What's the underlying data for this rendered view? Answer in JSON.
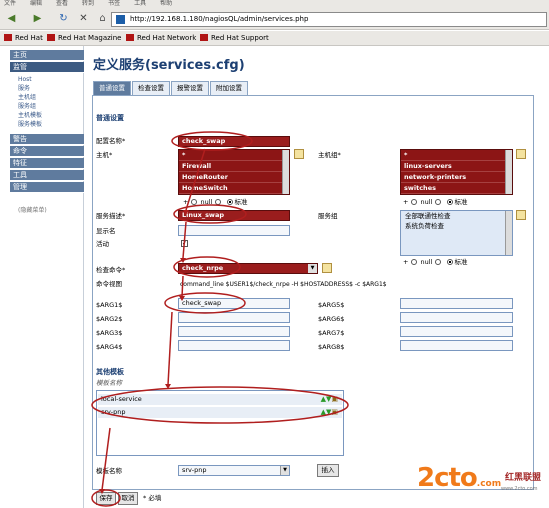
{
  "browser": {
    "menu": [
      "文件",
      "编辑",
      "查看",
      "转到",
      "书签",
      "工具",
      "帮助"
    ],
    "url": "http://192.168.1.180/nagiosQL/admin/services.php",
    "bookmarks": [
      "Red Hat",
      "Red Hat Magazine",
      "Red Hat Network",
      "Red Hat Support"
    ]
  },
  "sidebar": {
    "sections": [
      {
        "label": "主页"
      },
      {
        "label": "监管",
        "items": [
          "Host",
          "服务",
          "主机组",
          "服务组",
          "主机模板",
          "服务模板"
        ]
      },
      {
        "label": "警告"
      },
      {
        "label": "命令"
      },
      {
        "label": "特征"
      },
      {
        "label": "工具"
      },
      {
        "label": "管理"
      }
    ],
    "version": "(隐藏菜单)"
  },
  "page": {
    "title": "定义服务(services.cfg)",
    "tabs": [
      "普通设置",
      "检查设置",
      "报警设置",
      "附加设置"
    ],
    "section_common": "普通设置",
    "fields": {
      "config_name_label": "配置名称",
      "config_name_value": "check_swap",
      "hosts_label": "主机",
      "hosts_items": [
        "*",
        "Firewall",
        "HomeRouter",
        "HomeSwitch"
      ],
      "hostgroups_label": "主机组",
      "hostgroups_items": [
        "*",
        "linux-servers",
        "network-printers",
        "switches"
      ],
      "service_desc_label": "服务描述",
      "service_desc_value": "Linux_swap",
      "servicegroups_label": "服务组",
      "servicegroups_items": [
        "全部联通性检查",
        "系统负荷检查"
      ],
      "display_name_label": "显示名",
      "active_label": "活动",
      "check_command_label": "检查命令",
      "check_command_value": "check_nrpe",
      "command_view_label": "命令视图",
      "command_view_value": "command_line $USER1$/check_nrpe -H $HOSTADDRESS$ -c $ARG1$",
      "args_left": [
        "$ARG1$",
        "$ARG2$",
        "$ARG3$",
        "$ARG4$"
      ],
      "args_right": [
        "$ARG5$",
        "$ARG6$",
        "$ARG7$",
        "$ARG8$"
      ],
      "arg1_value": "check_swap"
    },
    "radio_labels": [
      "+",
      "null",
      "标准"
    ],
    "section_templates": "其他模板",
    "template_name_header": "模板名称",
    "templates": [
      "local-service",
      "srv-pnp"
    ],
    "template_select_label": "模板名称",
    "template_select_value": "srv-pnp",
    "insert_button": "插入",
    "save_button": "保存",
    "cancel_button": "取消",
    "required_note": "* 必填"
  },
  "watermark": {
    "logo": "2cto",
    "suffix": ".com",
    "brand": "红黑联盟",
    "url": "www.2cto.com"
  }
}
